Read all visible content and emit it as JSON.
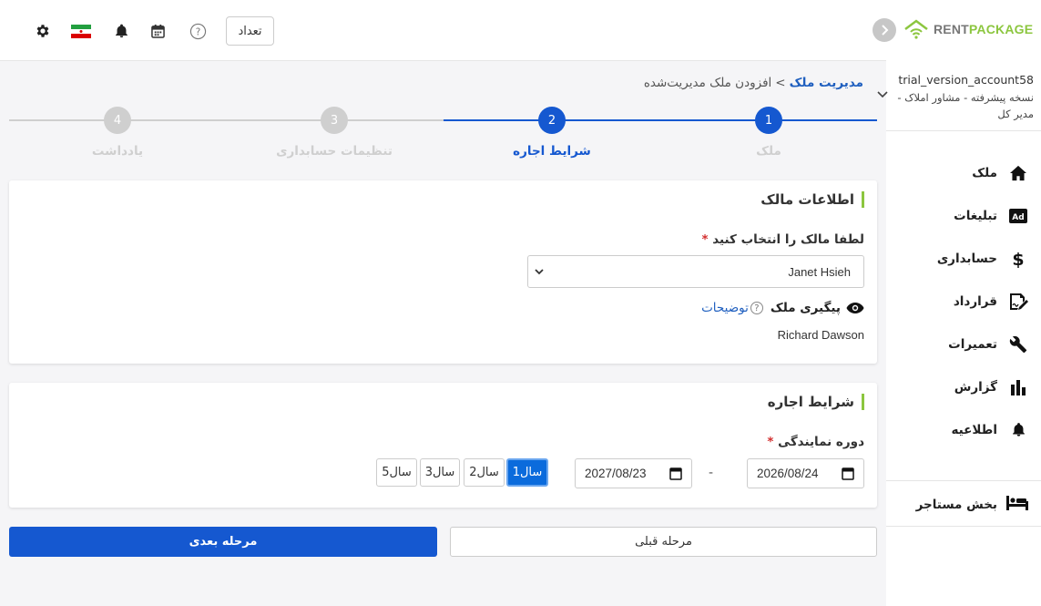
{
  "header": {
    "count_button": "تعداد",
    "icons": [
      "settings-icon",
      "iran-flag-icon",
      "bell-icon",
      "calendar-icon",
      "help-icon"
    ]
  },
  "brand": {
    "rent": "RENT",
    "package": "PACKAGE",
    "accent": "#8cc63f"
  },
  "account": {
    "name": "trial_version_account58",
    "role": "نسخه پیشرفته - مشاور املاک - مدیر کل"
  },
  "sidebar": {
    "items": [
      {
        "label": "ملک",
        "icon": "home-icon"
      },
      {
        "label": "تبلیغات",
        "icon": "ad-icon"
      },
      {
        "label": "حسابداری",
        "icon": "dollar-icon"
      },
      {
        "label": "قرارداد",
        "icon": "contract-icon"
      },
      {
        "label": "تعمیرات",
        "icon": "wrench-icon"
      },
      {
        "label": "گزارش",
        "icon": "chart-icon"
      },
      {
        "label": "اطلاعیه",
        "icon": "bell-icon"
      }
    ],
    "tenant": {
      "label": "بخش مستاجر",
      "icon": "bed-icon"
    }
  },
  "breadcrumb": {
    "parent": "مدیریت ملک",
    "separator": ">",
    "current": "افزودن ملک مدیریت‌شده"
  },
  "stepper": {
    "steps": [
      {
        "number": "1",
        "label": "ملک",
        "state": "done"
      },
      {
        "number": "2",
        "label": "شرایط اجاره",
        "state": "active"
      },
      {
        "number": "3",
        "label": "تنظیمات حسابداری",
        "state": "pending"
      },
      {
        "number": "4",
        "label": "یادداشت",
        "state": "pending"
      }
    ],
    "active_color": "#1558d0",
    "pending_color": "#cfcfcf"
  },
  "owner_card": {
    "title": "اطلاعات مالک",
    "select_label": "لطفا مالک را انتخاب کنید",
    "required_mark": "*",
    "selected_owner": "Janet Hsieh",
    "tracking_label": "پیگیری ملک",
    "description_link": "توضیحات",
    "help_mark": "?",
    "tracker_name": "Richard Dawson"
  },
  "lease_card": {
    "title": "شرایط اجاره",
    "period_label": "دوره نمایندگی",
    "required_mark": "*",
    "start_date": "2026/08/24",
    "end_date": "2027/08/23",
    "dash": "-",
    "year_options": [
      "1سال",
      "2سال",
      "3سال",
      "5سال"
    ],
    "selected_year": "1سال"
  },
  "actions": {
    "previous": "مرحله قبلی",
    "next": "مرحله بعدی"
  }
}
